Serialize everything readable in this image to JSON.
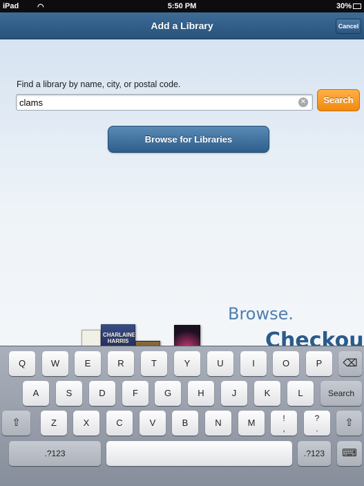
{
  "status_bar": {
    "device": "iPad",
    "time": "5:50 PM",
    "battery": "30%"
  },
  "nav": {
    "title": "Add a Library",
    "cancel_label": "Cancel"
  },
  "search": {
    "prompt": "Find a library by name, city, or postal code.",
    "value": "clams",
    "button_label": "Search"
  },
  "browse_button_label": "Browse for Libraries",
  "promo": {
    "browse": "Browse.",
    "checkout": "Checkout.",
    "book_title": "CHARLAINE HARRIS"
  },
  "keyboard": {
    "row1": [
      "Q",
      "W",
      "E",
      "R",
      "T",
      "Y",
      "U",
      "I",
      "O",
      "P"
    ],
    "row2": [
      "A",
      "S",
      "D",
      "F",
      "G",
      "H",
      "J",
      "K",
      "L"
    ],
    "row3": [
      "Z",
      "X",
      "C",
      "V",
      "B",
      "N",
      "M"
    ],
    "punct1": {
      "top": "!",
      "bottom": ","
    },
    "punct2": {
      "top": "?",
      "bottom": "."
    },
    "search_key": "Search",
    "numbers_left": ".?123",
    "numbers_right": ".?123",
    "icons": {
      "backspace": "backspace-icon",
      "shift": "shift-icon",
      "hide": "keyboard-hide-icon"
    }
  },
  "colors": {
    "nav": "#2f5d88",
    "search_button": "#f5930f",
    "browse_button": "#3f6f9d"
  }
}
